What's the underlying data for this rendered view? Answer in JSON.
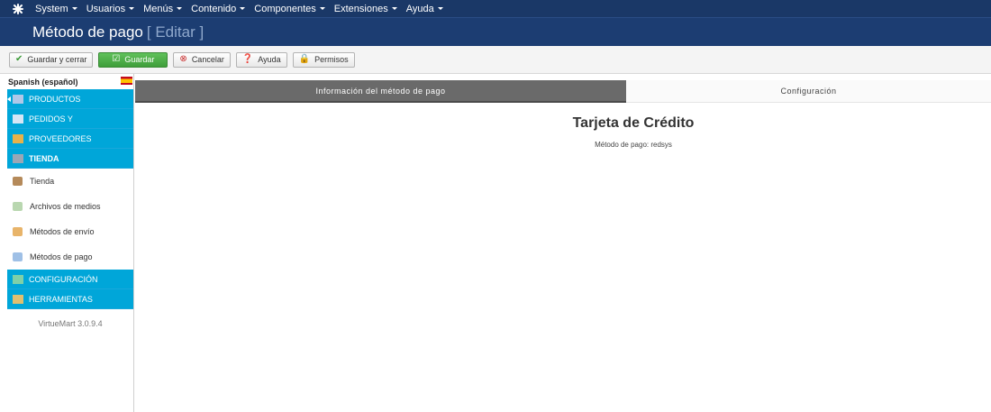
{
  "topnav": {
    "logo_icon": "joomla-icon",
    "items": [
      "System",
      "Usuarios",
      "Menús",
      "Contenido",
      "Componentes",
      "Extensiones",
      "Ayuda"
    ]
  },
  "header": {
    "title": "Método de pago",
    "subtitle": "[ Editar ]"
  },
  "toolbar": {
    "save_close": "Guardar y cerrar",
    "save": "Guardar",
    "cancel": "Cancelar",
    "help": "Ayuda",
    "permissions": "Permisos"
  },
  "sidebar": {
    "language": "Spanish (español)",
    "categories": [
      {
        "label": "PRODUCTOS"
      },
      {
        "label": "PEDIDOS Y"
      },
      {
        "label": "PROVEEDORES"
      },
      {
        "label": "TIENDA"
      }
    ],
    "subitems": [
      {
        "label": "Tienda"
      },
      {
        "label": "Archivos de medios"
      },
      {
        "label": "Métodos de envío"
      },
      {
        "label": "Métodos de pago"
      }
    ],
    "categories2": [
      {
        "label": "CONFIGURACIÓN"
      },
      {
        "label": "HERRAMIENTAS"
      }
    ],
    "version": "VirtueMart 3.0.9.4"
  },
  "main": {
    "tabs": [
      {
        "label": "Información del método de pago"
      },
      {
        "label": "Configuración"
      }
    ],
    "heading": "Tarjeta de Crédito",
    "method_line": "Método de pago: redsys"
  },
  "colors": {
    "nav_bg": "#1a3867",
    "accent": "#00a6d9",
    "save_green": "#4cae46"
  }
}
